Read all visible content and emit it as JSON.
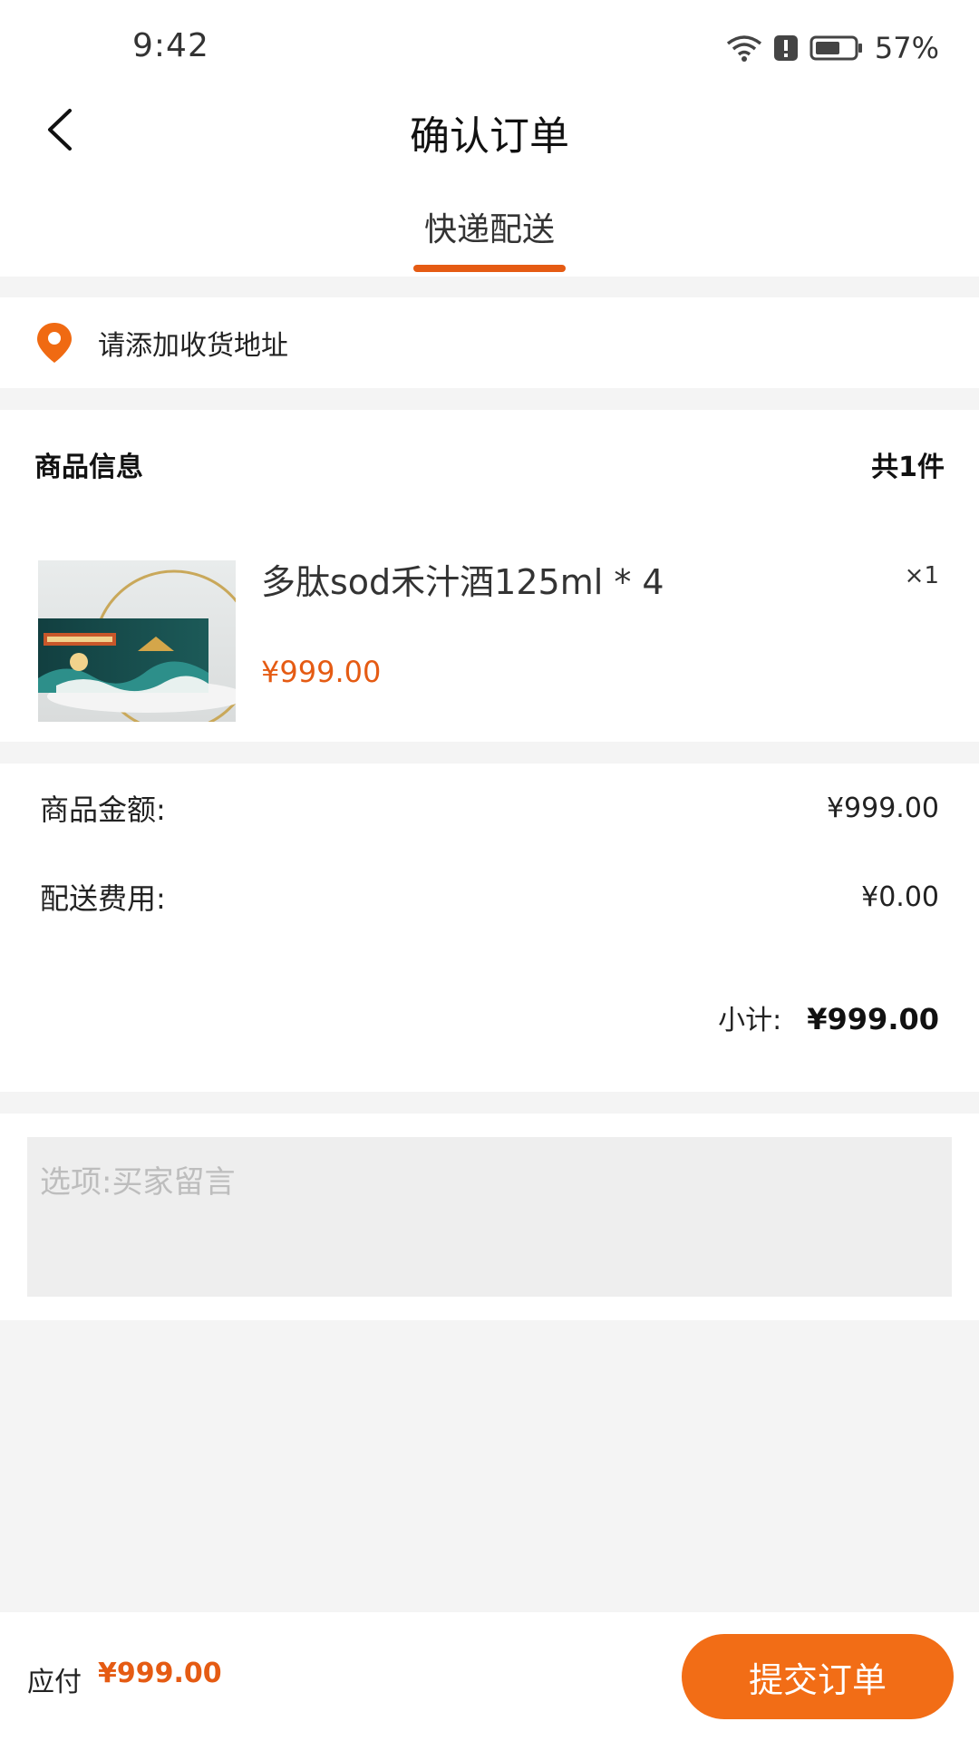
{
  "status_bar": {
    "time": "9:42",
    "battery": "57%",
    "icons": [
      "wifi-icon",
      "alert-icon",
      "battery-icon"
    ]
  },
  "nav": {
    "title": "确认订单",
    "back_icon": "chevron-left-icon"
  },
  "tabs": [
    {
      "label": "快递配送",
      "active": true
    }
  ],
  "address": {
    "prompt": "请添加收货地址",
    "icon": "location-pin-icon"
  },
  "product_section": {
    "title": "商品信息",
    "count_label": "共1件",
    "items": [
      {
        "name": "多肽sod禾汁酒125ml * 4",
        "price": "¥999.00",
        "quantity": "×1",
        "image": "product-box-image"
      }
    ]
  },
  "summary": {
    "goods_amount_label": "商品金额:",
    "goods_amount_value": "¥999.00",
    "shipping_label": "配送费用:",
    "shipping_value": "¥0.00",
    "subtotal_label": "小计:",
    "subtotal_value": "¥999.00"
  },
  "message": {
    "placeholder": "选项:买家留言",
    "value": ""
  },
  "footer": {
    "pay_label": "应付",
    "pay_amount": "¥999.00",
    "submit_label": "提交订单"
  },
  "colors": {
    "accent": "#e55b13",
    "button": "#f26d16",
    "page_bg": "#f4f4f4",
    "input_bg": "#eeeeee"
  }
}
